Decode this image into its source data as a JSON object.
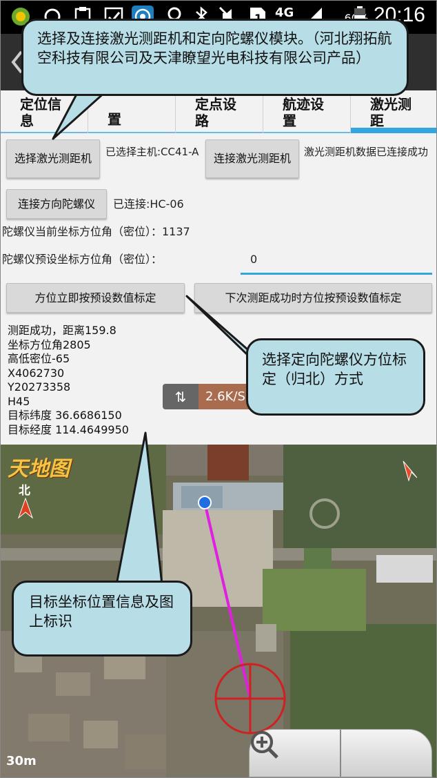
{
  "status_bar": {
    "network": "4G",
    "battery": "60%",
    "time": "20:16",
    "icons": [
      "app-icon",
      "circle-icon",
      "clipboard-icon",
      "check-icon",
      "radar-icon",
      "location-icon",
      "bluetooth-icon",
      "mute-icon",
      "sim-icon",
      "signal-icon",
      "battery-icon"
    ]
  },
  "tabs": [
    {
      "label": "定位信息"
    },
    {
      "label": "置"
    },
    {
      "label": "定点设路"
    },
    {
      "label": "航迹设置"
    },
    {
      "label": "激光测距",
      "active": true
    }
  ],
  "laser": {
    "select_button": "选择激光测距机",
    "selected_text": "已选择主机:CC41-A",
    "connect_button": "连接激光测距机",
    "status_text": "激光测距机数据已连接成功"
  },
  "gyro": {
    "connect_button": "连接方向陀螺仪",
    "status_text": "已连接:HC-06",
    "current_label": "陀螺仪当前坐标方位角（密位）：1137",
    "preset_label": "陀螺仪预设坐标方位角（密位）：",
    "preset_value": "0",
    "calibrate_now_button": "方位立即按预设数值标定",
    "calibrate_next_button": "下次测距成功时方位按预设数值标定"
  },
  "result": {
    "lines": [
      "测距成功，距离159.8",
      "坐标方位角2805",
      "高低密位-65",
      "X4062730",
      "Y20273358",
      "H45",
      "目标纬度 36.6686150",
      "目标经度 114.4649950"
    ]
  },
  "speed": {
    "value": "2.6K/S"
  },
  "map": {
    "logo": "天地图",
    "north_label": "北",
    "scale": "30m",
    "zoom_out_icon": "zoom-out-icon",
    "zoom_in_icon": "zoom-in-icon"
  },
  "callouts": {
    "top": "选择及连接激光测距机和定向陀螺仪模块。（河北翔拓航空科技有限公司及天津瞭望光电科技有限公司产品）",
    "right": "选择定向陀螺仪方位标定（归北）方式",
    "left": "目标坐标位置信息及图上标识"
  },
  "colors": {
    "accent": "#33a6df",
    "callout_fill": "#b7dde6",
    "track_line": "#e020e0",
    "target_ring": "#d02020"
  }
}
